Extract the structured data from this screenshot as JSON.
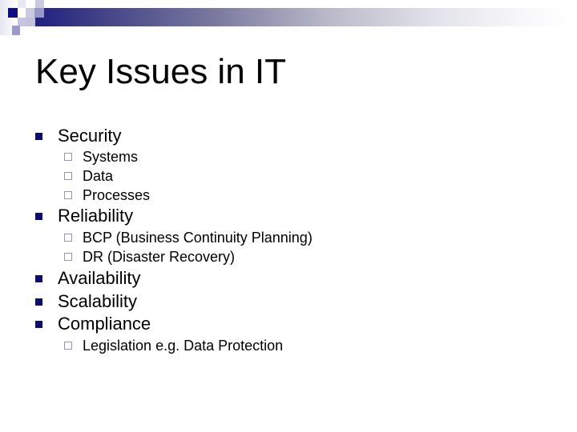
{
  "slide": {
    "title": "Key Issues in IT",
    "colors": {
      "bullet": "#0d0d6e",
      "sub_bullet_border": "#9595b3",
      "bar_start": "#1c1c80"
    },
    "items": [
      {
        "label": "Security",
        "sub": [
          "Systems",
          "Data",
          "Processes"
        ]
      },
      {
        "label": "Reliability",
        "sub": [
          "BCP (Business Continuity Planning)",
          "DR (Disaster Recovery)"
        ]
      },
      {
        "label": "Availability",
        "sub": []
      },
      {
        "label": "Scalability",
        "sub": []
      },
      {
        "label": "Compliance",
        "sub": [
          "Legislation e.g. Data Protection"
        ]
      }
    ]
  }
}
